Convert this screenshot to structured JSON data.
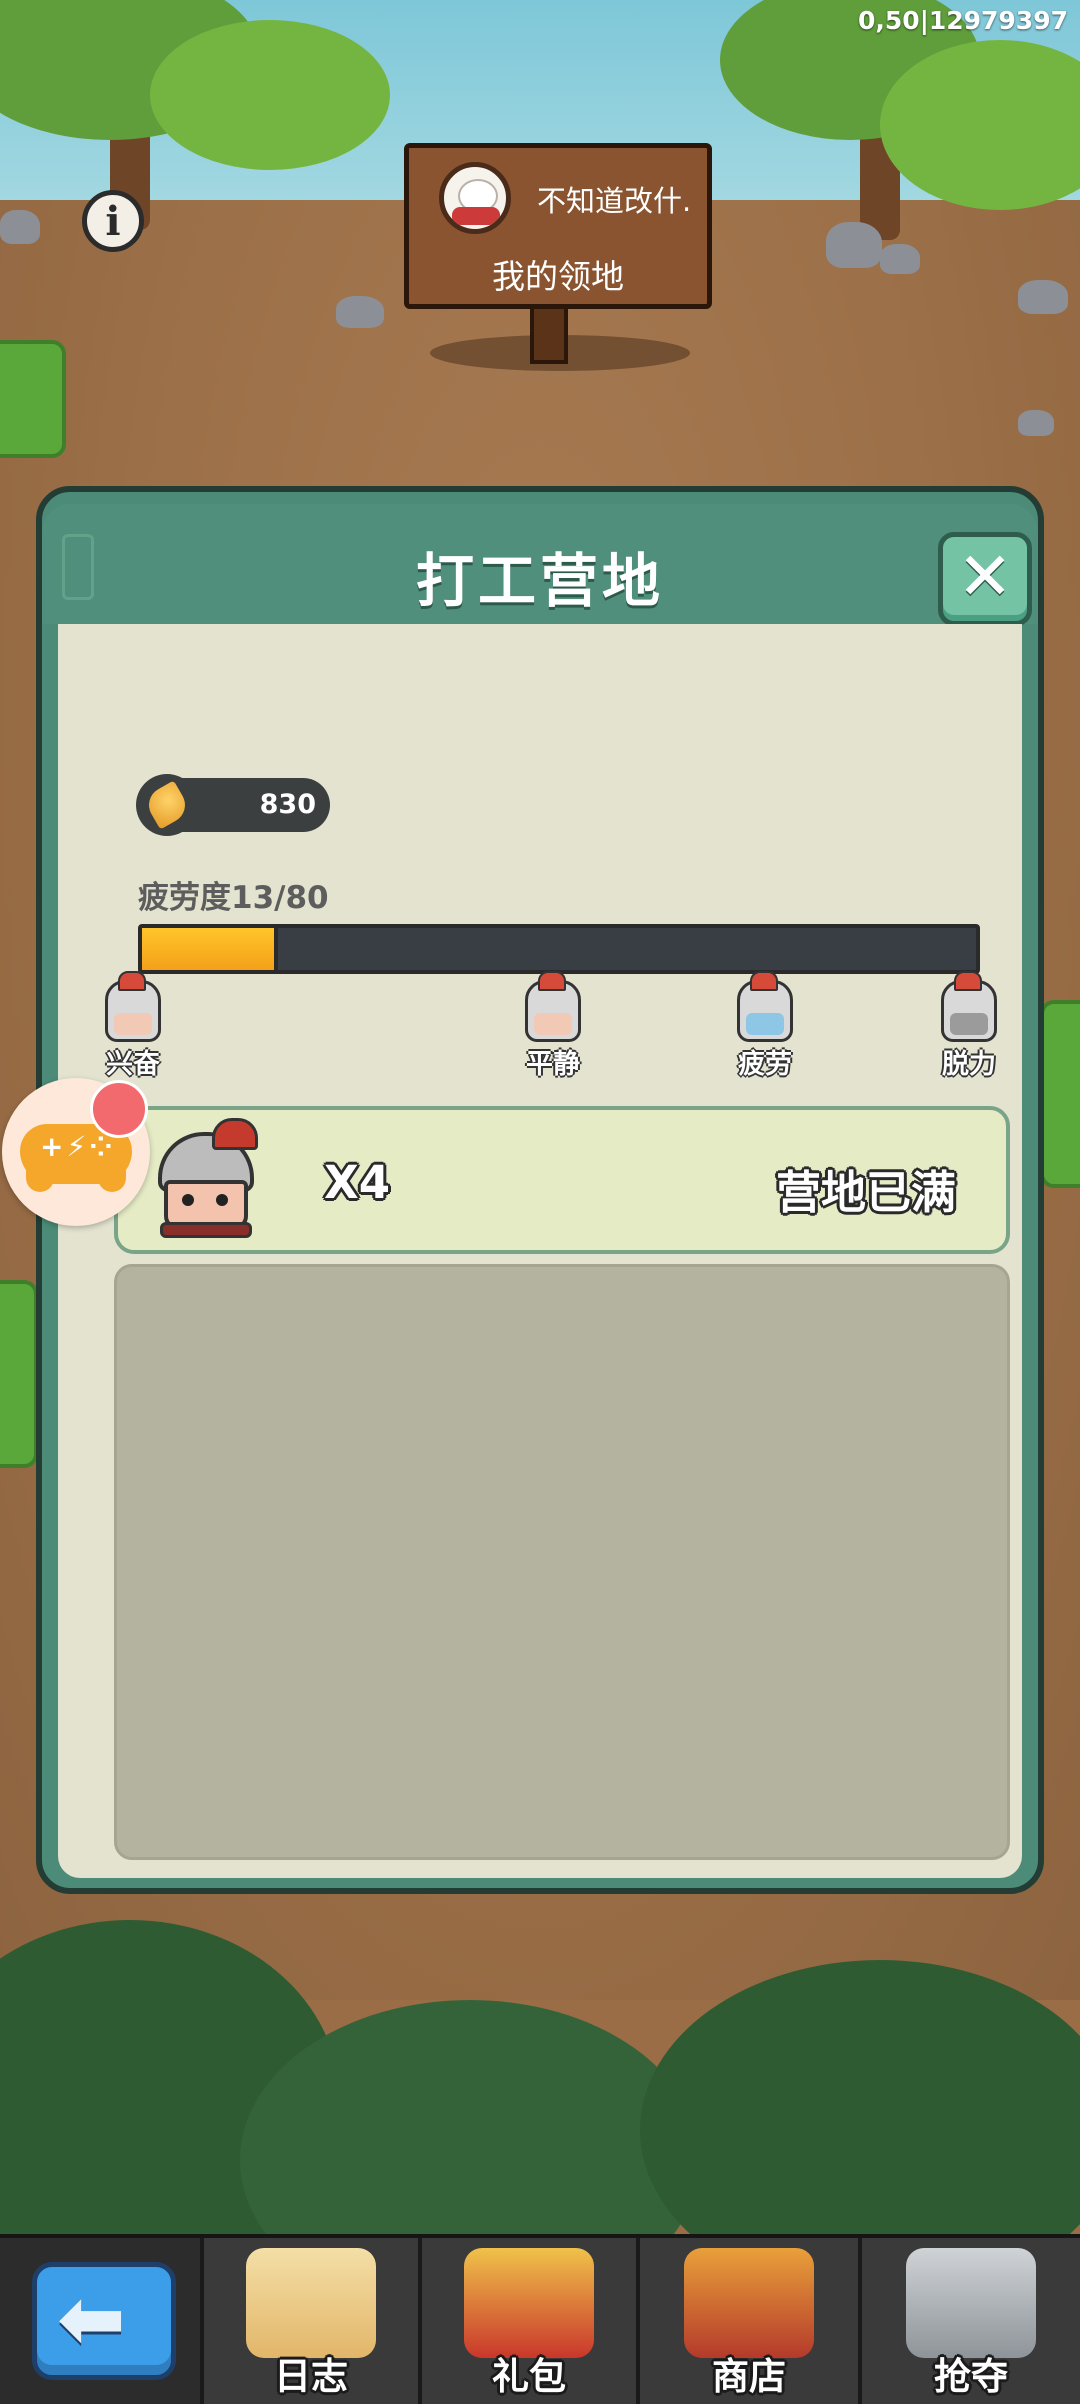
{
  "debug": {
    "text": "0,50|12979397"
  },
  "sign": {
    "player_name": "不知道改什.",
    "title": "我的领地"
  },
  "dialog": {
    "title": "打工营地",
    "close_icon": "close-icon",
    "resource": {
      "icon": "wheat-icon",
      "value": "830"
    },
    "fatigue": {
      "label": "疲劳度13/80",
      "current": 13,
      "max": 80,
      "color": "#f7b01f"
    },
    "moods": [
      {
        "label": "兴奋",
        "icon": "excited-soldier-icon"
      },
      {
        "label": "平静",
        "icon": "calm-soldier-icon"
      },
      {
        "label": "疲劳",
        "icon": "tired-soldier-icon"
      },
      {
        "label": "脱力",
        "icon": "exhausted-soldier-icon"
      }
    ],
    "worker": {
      "icon": "soldier-avatar-icon",
      "count": "X4",
      "status": "营地已满"
    }
  },
  "nav": {
    "back_icon": "back-arrow-icon",
    "items": [
      {
        "label": "日志",
        "icon": "scroll-paw-icon"
      },
      {
        "label": "礼包",
        "icon": "gift-pot-icon"
      },
      {
        "label": "商店",
        "icon": "shop-chest-icon"
      },
      {
        "label": "抢夺",
        "icon": "crossed-swords-shield-icon"
      }
    ]
  },
  "colors": {
    "dialog": "#4b8b77",
    "body": "#e3e3d0",
    "card": "#e4ebc5",
    "nav_bg": "#2c2c2c",
    "back_button": "#3c9ee8"
  }
}
